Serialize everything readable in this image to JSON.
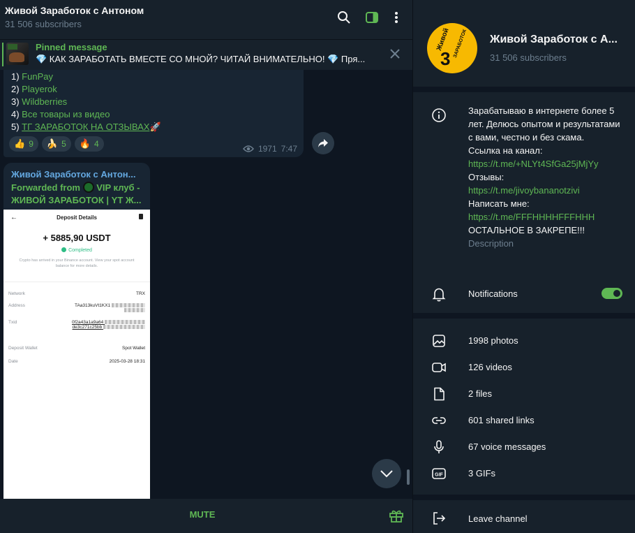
{
  "header": {
    "title": "Живой Заработок с Антоном",
    "subtitle": "31 506 subscribers"
  },
  "pinned": {
    "label": "Pinned message",
    "text": "💎 КАК ЗАРАБОТАТЬ ВМЕСТЕ СО МНОЙ? ЧИТАЙ ВНИМАТЕЛЬНО! 💎 Пря..."
  },
  "message1": {
    "items": [
      {
        "num": "1) ",
        "text": "FunPay"
      },
      {
        "num": "2) ",
        "text": "Playerok"
      },
      {
        "num": "3) ",
        "text": "Wildberries"
      },
      {
        "num": "4) ",
        "text": "Все товары из видео"
      },
      {
        "num": "5) ",
        "text": "ТГ ЗАРАБОТОК НА ОТЗЫВАХ",
        "suffix": "🚀"
      }
    ],
    "reactions": [
      {
        "emoji": "👍",
        "count": "9"
      },
      {
        "emoji": "🍌",
        "count": "5"
      },
      {
        "emoji": "🔥",
        "count": "4"
      }
    ],
    "views": "1971",
    "time": "7:47"
  },
  "message2": {
    "author": "Живой Заработок с Антон...",
    "forwarded_prefix": "Forwarded from",
    "forwarded_source": "VIP клуб - ЖИВОЙ ЗАРАБОТОК | YT Ж...",
    "screenshot": {
      "back": "←",
      "title": "Deposit Details",
      "amount": "+ 5885,90 USDT",
      "status": "Completed",
      "note": "Crypto has arrived in your Binance account. View your spot account balance for more details.",
      "rows": [
        {
          "key": "Network",
          "value": "TRX"
        },
        {
          "key": "Address",
          "value": "TAa313kuVt1KX1"
        },
        {
          "key": "Txid",
          "value": "0f2a43a1a9a64",
          "value2": "de3c271c25bb"
        },
        {
          "key": "Deposit Wallet",
          "value": "Spot Wallet"
        },
        {
          "key": "Date",
          "value": "2025-03-28 18:31"
        }
      ]
    }
  },
  "footer": {
    "mute_label": "MUTE"
  },
  "panel": {
    "name": "Живой Заработок с А...",
    "subscribers": "31 506 subscribers",
    "avatar_text_top": "Живой",
    "avatar_text_mid": "ЗАРАБОТОК",
    "avatar_digit": "3",
    "description": {
      "l1": "Зарабатываю в интернете более 5 лет. Делюсь опытом и результатами с вами, честно и без скама.",
      "l2": "Ссылка на канал:",
      "link1": "https://t.me/+NLYt4SfGa25jMjYy",
      "l3": "Отзывы:",
      "link2": "https://t.me/jivoybananotzivi",
      "l4": "Написать мне:",
      "link3": "https://t.me/FFFHHHHFFFHHH",
      "l5": "ОСТАЛЬНОЕ В ЗАКРЕПЕ!!!",
      "caption": "Description"
    },
    "notifications_label": "Notifications",
    "notifications_on": true,
    "media": [
      {
        "icon": "photo-icon",
        "label": "1998 photos"
      },
      {
        "icon": "video-icon",
        "label": "126 videos"
      },
      {
        "icon": "file-icon",
        "label": "2 files"
      },
      {
        "icon": "link-icon",
        "label": "601 shared links"
      },
      {
        "icon": "microphone-icon",
        "label": "67 voice messages"
      },
      {
        "icon": "gif-icon",
        "label": "3 GIFs",
        "badge": "GIF"
      }
    ],
    "leave_label": "Leave channel"
  },
  "colors": {
    "accent": "#5fb754",
    "author": "#64a8e0",
    "bg": "#0e1621",
    "surface": "#17212b",
    "bubble": "#182533",
    "muted": "#6d7f8f"
  }
}
